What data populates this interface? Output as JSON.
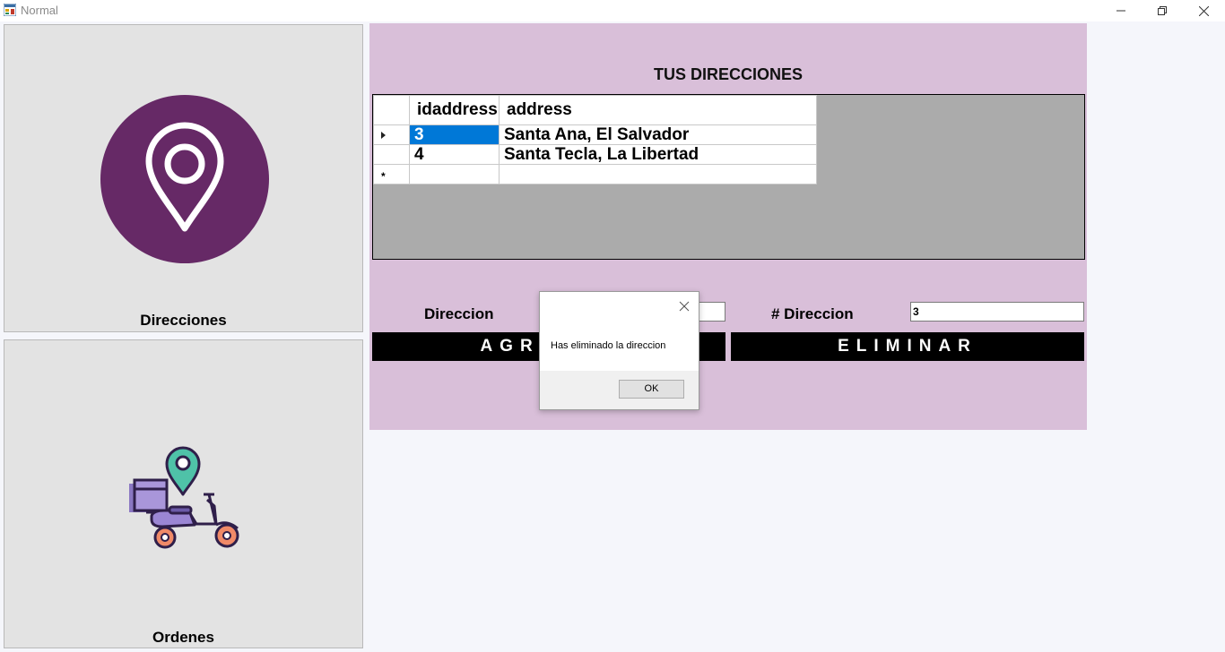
{
  "window": {
    "title": "Normal"
  },
  "sidebar": {
    "tiles": [
      {
        "label": "Direcciones",
        "icon": "map-pin-icon"
      },
      {
        "label": "Ordenes",
        "icon": "delivery-scooter-icon"
      }
    ]
  },
  "main": {
    "title": "TUS DIRECCIONES",
    "grid": {
      "columns": [
        "idaddress",
        "address"
      ],
      "rows": [
        {
          "id": "3",
          "address": "Santa Ana, El Salvador"
        },
        {
          "id": "4",
          "address": "Santa Tecla, La Libertad"
        }
      ],
      "new_row_marker": "*"
    },
    "form": {
      "direccion_label": "Direccion",
      "direccion_value": "",
      "num_direccion_label": "# Direccion",
      "num_direccion_value": "3",
      "add_button": "AGREGAR",
      "delete_button": "ELIMINAR"
    }
  },
  "dialog": {
    "message": "Has eliminado la direccion",
    "ok_label": "OK"
  },
  "colors": {
    "panel_bg": "#d9bfd9",
    "accent_purple": "#662966",
    "selection": "#0078d7",
    "button_bg": "#000000"
  }
}
